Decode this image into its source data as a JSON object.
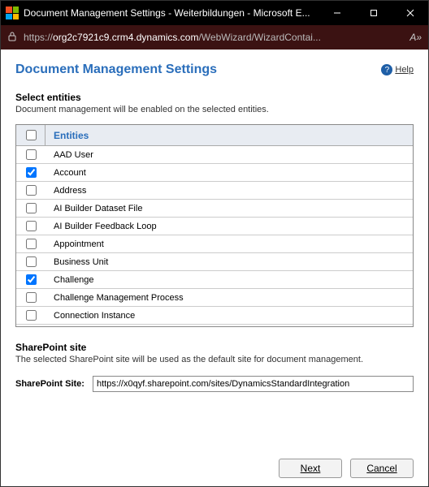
{
  "window": {
    "title": "Document Management Settings - Weiterbildungen - Microsoft E..."
  },
  "address": {
    "prefix": "https://",
    "domain": "org2c7921c9.crm4.dynamics.com",
    "path": "/WebWizard/WizardContai...",
    "reader_label": "A»"
  },
  "page": {
    "title": "Document Management Settings",
    "help_label": "Help"
  },
  "select_entities": {
    "heading": "Select entities",
    "description": "Document management will be enabled on the selected entities.",
    "column_header": "Entities",
    "rows": [
      {
        "label": "AAD User",
        "checked": false
      },
      {
        "label": "Account",
        "checked": true
      },
      {
        "label": "Address",
        "checked": false
      },
      {
        "label": "AI Builder Dataset File",
        "checked": false
      },
      {
        "label": "AI Builder Feedback Loop",
        "checked": false
      },
      {
        "label": "Appointment",
        "checked": false
      },
      {
        "label": "Business Unit",
        "checked": false
      },
      {
        "label": "Challenge",
        "checked": true
      },
      {
        "label": "Challenge Management Process",
        "checked": false
      },
      {
        "label": "Connection Instance",
        "checked": false
      }
    ]
  },
  "sharepoint": {
    "heading": "SharePoint site",
    "description": "The selected SharePoint site will be used as the default site for document management.",
    "field_label": "SharePoint Site:",
    "value": "https://x0qyf.sharepoint.com/sites/DynamicsStandardIntegration"
  },
  "buttons": {
    "next": "Next",
    "cancel": "Cancel"
  }
}
